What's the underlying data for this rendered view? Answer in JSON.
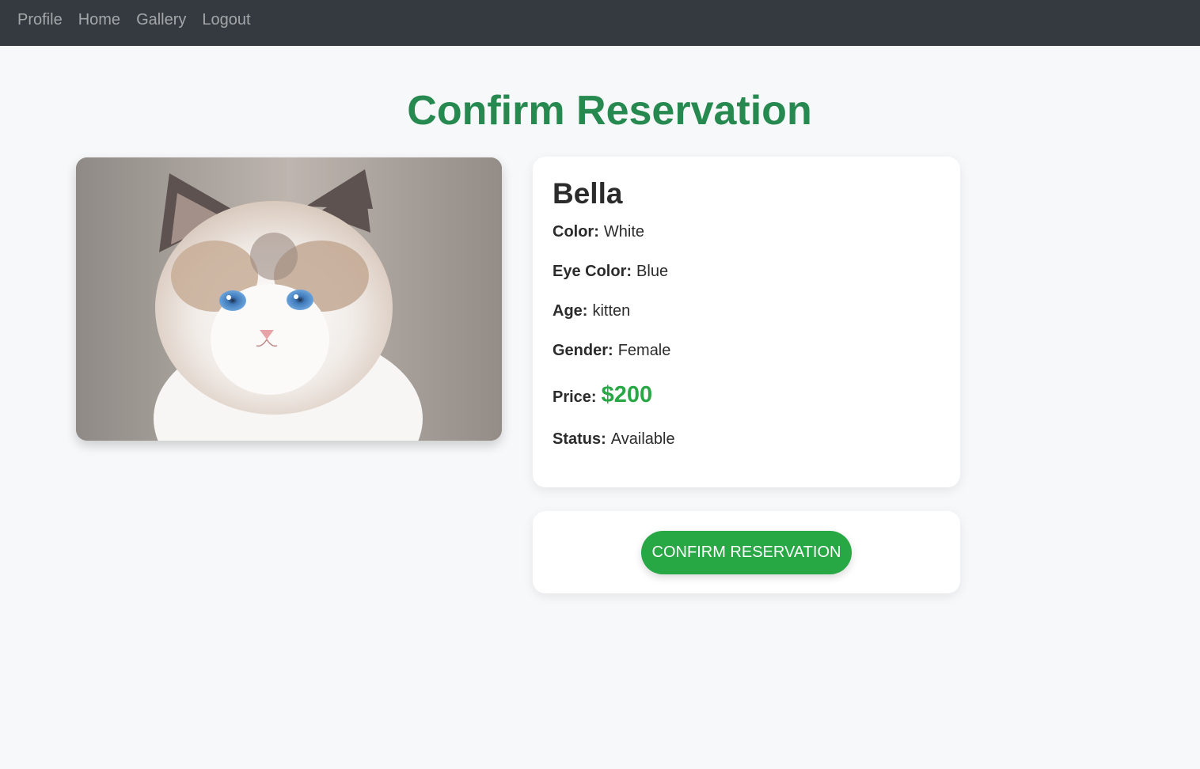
{
  "nav": {
    "items": [
      {
        "label": "Profile"
      },
      {
        "label": "Home"
      },
      {
        "label": "Gallery"
      },
      {
        "label": "Logout"
      }
    ]
  },
  "page": {
    "title": "Confirm Reservation"
  },
  "cat": {
    "name": "Bella",
    "image_icon": "kitten-photo",
    "fields": {
      "color": {
        "label": "Color:",
        "value": "White"
      },
      "eye_color": {
        "label": "Eye Color:",
        "value": "Blue"
      },
      "age": {
        "label": "Age:",
        "value": "kitten"
      },
      "gender": {
        "label": "Gender:",
        "value": "Female"
      },
      "price": {
        "label": "Price:",
        "value": "$200"
      },
      "status": {
        "label": "Status:",
        "value": "Available"
      }
    }
  },
  "actions": {
    "confirm_label": "CONFIRM RESERVATION"
  },
  "colors": {
    "navbar": "#343a40",
    "title": "#26894f",
    "accent": "#28a745",
    "background": "#f7f8fa"
  }
}
